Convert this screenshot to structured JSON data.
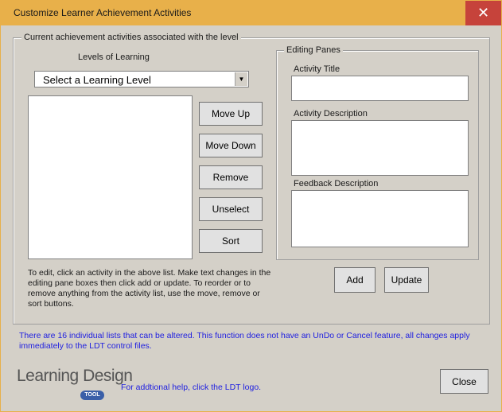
{
  "window": {
    "title": "Customize Learner Achievement Activities",
    "close_glyph": "✕"
  },
  "current_group": {
    "label": "Current achievement activities associated with the level"
  },
  "levels": {
    "label": "Levels of Learning",
    "selected": "Select a Learning Level"
  },
  "buttons": {
    "move_up": "Move Up",
    "move_down": "Move Down",
    "remove": "Remove",
    "unselect": "Unselect",
    "sort": "Sort",
    "add": "Add",
    "update": "Update",
    "close": "Close"
  },
  "editing": {
    "group_label": "Editing Panes",
    "activity_title_label": "Activity Title",
    "activity_description_label": "Activity Description",
    "feedback_description_label": "Feedback Description",
    "activity_title_value": "",
    "activity_description_value": "",
    "feedback_description_value": ""
  },
  "help_text": "To edit, click an activity in the above list. Make text changes in the editing pane boxes then click add or update. To reorder or to remove anything from the activity list, use the move, remove or sort buttons.",
  "footer": {
    "notice": "There are 16 individual lists that can be altered. This function does not have an UnDo or Cancel feature, all changes apply immediately to the LDT control files.",
    "help_link": "For addtional help, click the LDT logo.",
    "logo_text": "Learning Design",
    "logo_badge": "TOOL"
  },
  "colors": {
    "titlebar": "#e8b04a",
    "close_button": "#c6433b",
    "notice_text": "#2020e0",
    "dialog_bg": "#d4d0c8"
  },
  "icons": {
    "close": "close-icon",
    "dropdown": "chevron-down-icon"
  }
}
